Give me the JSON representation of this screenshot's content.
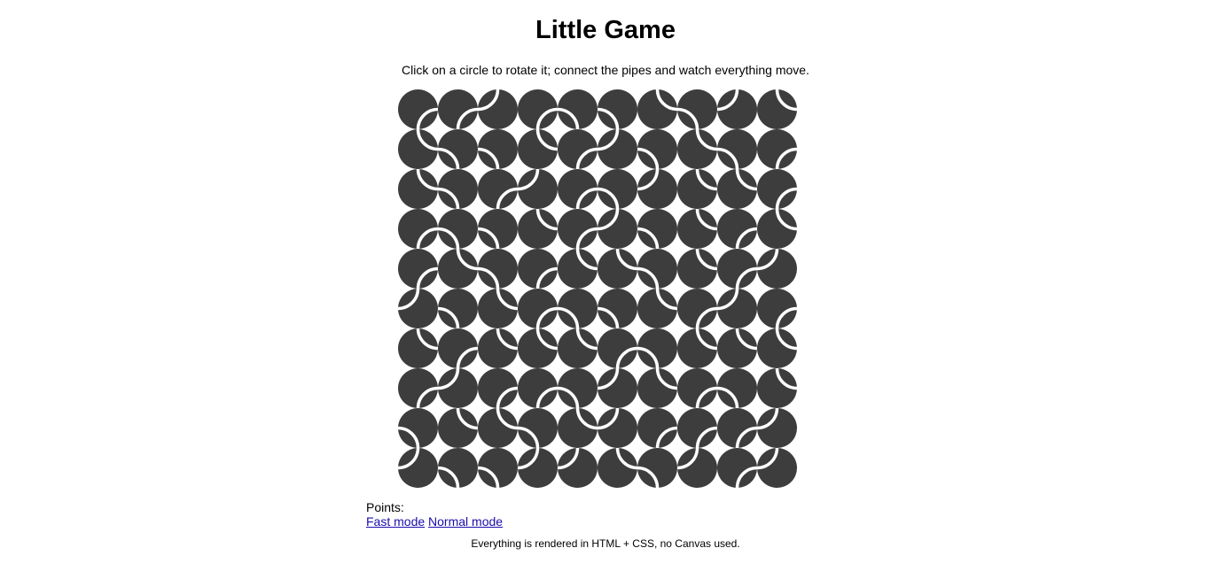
{
  "header": {
    "title": "Little Game",
    "instructions": "Click on a circle to rotate it; connect the pipes and watch everything move."
  },
  "board": {
    "rows": 10,
    "cols": 10,
    "circle_color": "#3d3d3d",
    "pipe_color": "#ffffff",
    "corner_names": [
      "top-left",
      "top-right",
      "bottom-right",
      "bottom-left"
    ],
    "tiles": [
      [
        2,
        2,
        0,
        2,
        3,
        3,
        1,
        3,
        0,
        1
      ],
      [
        1,
        3,
        3,
        1,
        2,
        0,
        3,
        1,
        3,
        2
      ],
      [
        1,
        3,
        2,
        0,
        2,
        3,
        0,
        1,
        1,
        2
      ],
      [
        2,
        3,
        3,
        1,
        2,
        0,
        3,
        1,
        2,
        1
      ],
      [
        2,
        1,
        3,
        2,
        1,
        1,
        3,
        1,
        2,
        0
      ],
      [
        0,
        3,
        1,
        2,
        3,
        3,
        1,
        2,
        0,
        2
      ],
      [
        1,
        2,
        1,
        1,
        1,
        2,
        3,
        1,
        1,
        1
      ],
      [
        2,
        0,
        2,
        2,
        3,
        0,
        1,
        2,
        3,
        1
      ],
      [
        3,
        1,
        1,
        3,
        1,
        0,
        2,
        2,
        2,
        0
      ],
      [
        0,
        3,
        3,
        0,
        0,
        1,
        3,
        0,
        2,
        0
      ]
    ]
  },
  "status": {
    "points_label": "Points:",
    "points_value": ""
  },
  "modes": {
    "fast_label": "Fast mode",
    "normal_label": "Normal mode"
  },
  "footer": {
    "note": "Everything is rendered in HTML + CSS, no Canvas used."
  }
}
